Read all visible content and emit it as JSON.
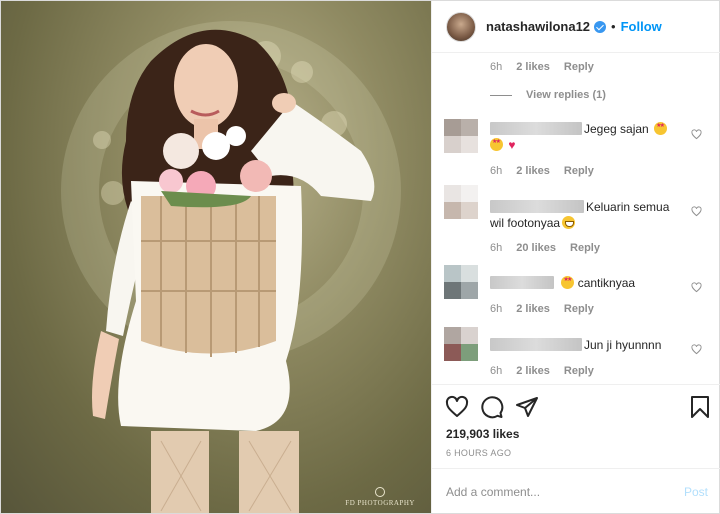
{
  "post": {
    "username": "natashawilona12",
    "verified_icon": "verified-badge-icon",
    "separator": "•",
    "follow_label": "Follow",
    "photo_credit": "FD PHOTOGRAPHY"
  },
  "top_reply_meta": {
    "time": "6h",
    "likes": "2 likes",
    "reply": "Reply"
  },
  "view_replies": "View replies (1)",
  "comments": [
    {
      "user": "prumshop9",
      "text": "Jegeg sajan",
      "emojis_line1": [
        "star-struck-emoji"
      ],
      "emojis_line2": [
        "star-struck-emoji",
        "red-heart-emoji"
      ],
      "time": "6h",
      "likes": "2 likes",
      "reply": "Reply",
      "avatar_colors": [
        "#a79c95",
        "#b9b0aa",
        "#d8d0cc",
        "#e7e1de"
      ]
    },
    {
      "user": "",
      "text": "Keluarin semua",
      "text2": "wil footonyaa",
      "emojis_line2": [
        "grinning-emoji"
      ],
      "time": "6h",
      "likes": "20 likes",
      "reply": "Reply",
      "avatar_colors": [
        "#e9e5e3",
        "#f3f1f0",
        "#c6b7ad",
        "#ddd3cc"
      ]
    },
    {
      "user": "",
      "text": "cantiknyaa",
      "emojis_before": [
        "star-struck-emoji"
      ],
      "time": "6h",
      "likes": "2 likes",
      "reply": "Reply",
      "avatar_colors": [
        "#b9c5c7",
        "#d9dfdf",
        "#6e7678",
        "#9ea6a8"
      ]
    },
    {
      "user": "",
      "text": "Jun ji hyunnnn",
      "time": "6h",
      "likes": "2 likes",
      "reply": "Reply",
      "avatar_colors": [
        "#b0a6a1",
        "#d9d2cf",
        "#8c5a57",
        "#7d9e7b"
      ]
    }
  ],
  "actions": {
    "like_icon": "heart-outline-icon",
    "comment_icon": "comment-bubble-icon",
    "share_icon": "paper-plane-icon",
    "save_icon": "bookmark-icon"
  },
  "likes_count": "219,903 likes",
  "time_ago": "6 HOURS AGO",
  "add_comment": {
    "placeholder": "Add a comment...",
    "post_label": "Post"
  },
  "colors": {
    "accent": "#0095f6",
    "post_disabled": "#b2dffc",
    "meta": "#8e8e8e",
    "text": "#262626",
    "verified": "#3897f0"
  }
}
